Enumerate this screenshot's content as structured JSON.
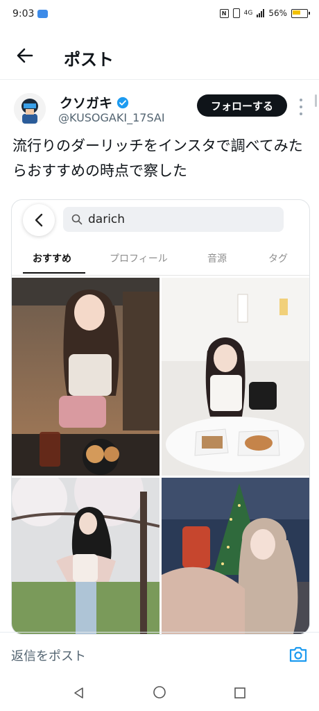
{
  "status": {
    "time": "9:03",
    "network": "4G",
    "battery": "56%"
  },
  "header": {
    "title": "ポスト"
  },
  "author": {
    "display_name": "クソガキ",
    "handle": "@KUSOGAKI_17SAI",
    "follow_label": "フォローする"
  },
  "tweet": {
    "text": "流行りのダーリッチをインスタで調べてみたらおすすめの時点で察した"
  },
  "media": {
    "search_query": "darich",
    "tabs": [
      {
        "label": "おすすめ",
        "active": true
      },
      {
        "label": "プロフィール",
        "active": false
      },
      {
        "label": "音源",
        "active": false
      },
      {
        "label": "タグ",
        "active": false
      }
    ]
  },
  "reply": {
    "placeholder": "返信をポスト"
  },
  "colors": {
    "follow_bg": "#0f1419",
    "verified": "#1d9bf0",
    "camera": "#1d9bf0"
  }
}
